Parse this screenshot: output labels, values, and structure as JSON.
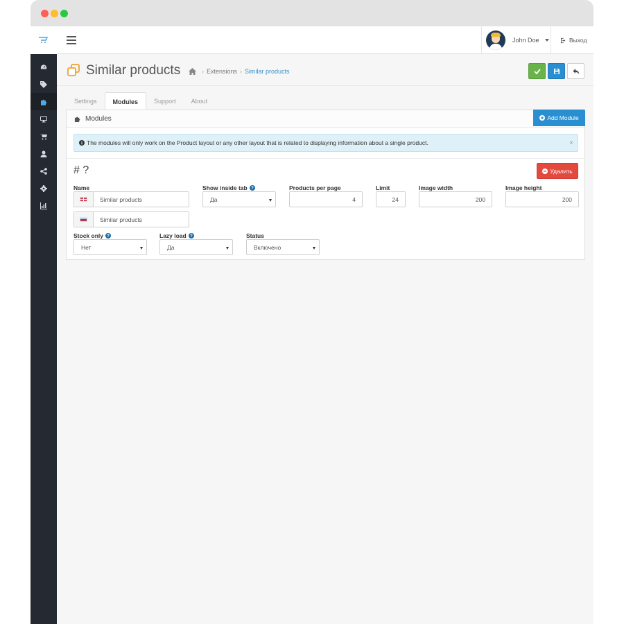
{
  "window": {
    "controls": [
      "close",
      "minimize",
      "maximize"
    ]
  },
  "sidebar": {
    "logo_icon": "opencart-cart-logo",
    "items": [
      {
        "icon": "dashboard-icon",
        "active": false
      },
      {
        "icon": "tags-icon",
        "active": false
      },
      {
        "icon": "puzzle-icon",
        "active": true
      },
      {
        "icon": "monitor-icon",
        "active": false
      },
      {
        "icon": "cart-icon",
        "active": false
      },
      {
        "icon": "user-icon",
        "active": false
      },
      {
        "icon": "share-icon",
        "active": false
      },
      {
        "icon": "cog-icon",
        "active": false
      },
      {
        "icon": "bar-chart-icon",
        "active": false
      }
    ]
  },
  "topbar": {
    "user_name": "John Doe",
    "logout_label": "Выход"
  },
  "header": {
    "title": "Similar products",
    "breadcrumb": {
      "extensions": "Extensions",
      "current": "Similar products"
    },
    "colors": {
      "save_green": "#68b34a",
      "save_blue": "#2a8fd0",
      "danger": "#e3493d"
    }
  },
  "tabs": [
    {
      "label": "Settings",
      "active": false
    },
    {
      "label": "Modules",
      "active": true
    },
    {
      "label": "Support",
      "active": false
    },
    {
      "label": "About",
      "active": false
    }
  ],
  "panel": {
    "title": "Modules",
    "add_module_label": "Add Module",
    "alert_text": "The modules will only work on the Product layout or any other layout that is related to displaying information about a single product.",
    "alert_close": "×",
    "module_title": "# ?",
    "delete_label": "Удалить",
    "fields": {
      "name_label": "Name",
      "name_en": "Similar products",
      "name_ru": "Similar products",
      "show_inside_tab_label": "Show inside tab",
      "show_inside_tab_value": "Да",
      "products_per_page_label": "Products per page",
      "products_per_page_value": "4",
      "limit_label": "Limit",
      "limit_value": "24",
      "image_width_label": "Image width",
      "image_width_value": "200",
      "image_height_label": "Image height",
      "image_height_value": "200",
      "stock_only_label": "Stock only",
      "stock_only_value": "Нет",
      "lazy_load_label": "Lazy load",
      "lazy_load_value": "Да",
      "status_label": "Status",
      "status_value": "Включено"
    }
  }
}
